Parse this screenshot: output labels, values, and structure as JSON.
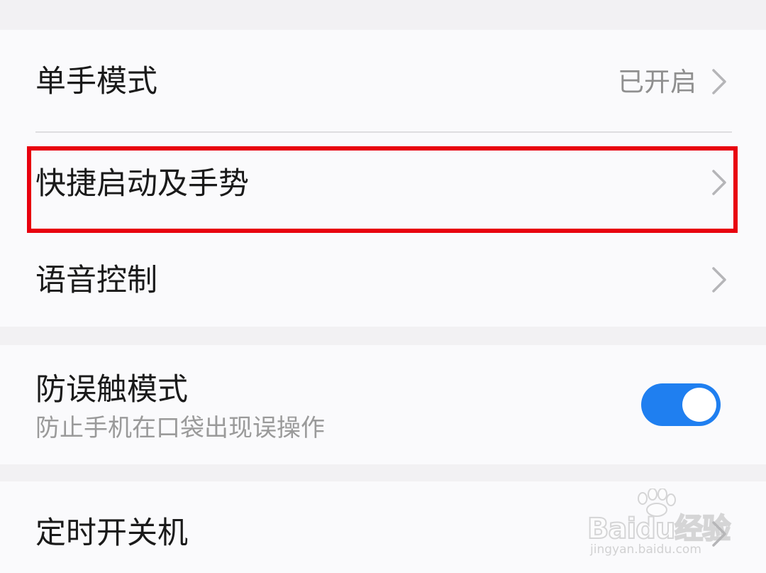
{
  "settings": {
    "one_hand_mode": {
      "label": "单手模式",
      "status": "已开启"
    },
    "quick_launch_gestures": {
      "label": "快捷启动及手势"
    },
    "voice_control": {
      "label": "语音控制"
    },
    "pocket_mode": {
      "label": "防误触模式",
      "description": "防止手机在口袋出现误操作",
      "enabled": true
    },
    "scheduled_power": {
      "label": "定时开关机"
    }
  },
  "annotation": {
    "highlight_color": "#e8000e",
    "highlighted_item": "快捷启动及手势"
  },
  "watermark": {
    "brand": "Baidu经验",
    "url": "jingyan.baidu.com"
  },
  "colors": {
    "toggle_on": "#1f7ff0",
    "background": "#f2f1f3",
    "card": "#fafafc"
  }
}
